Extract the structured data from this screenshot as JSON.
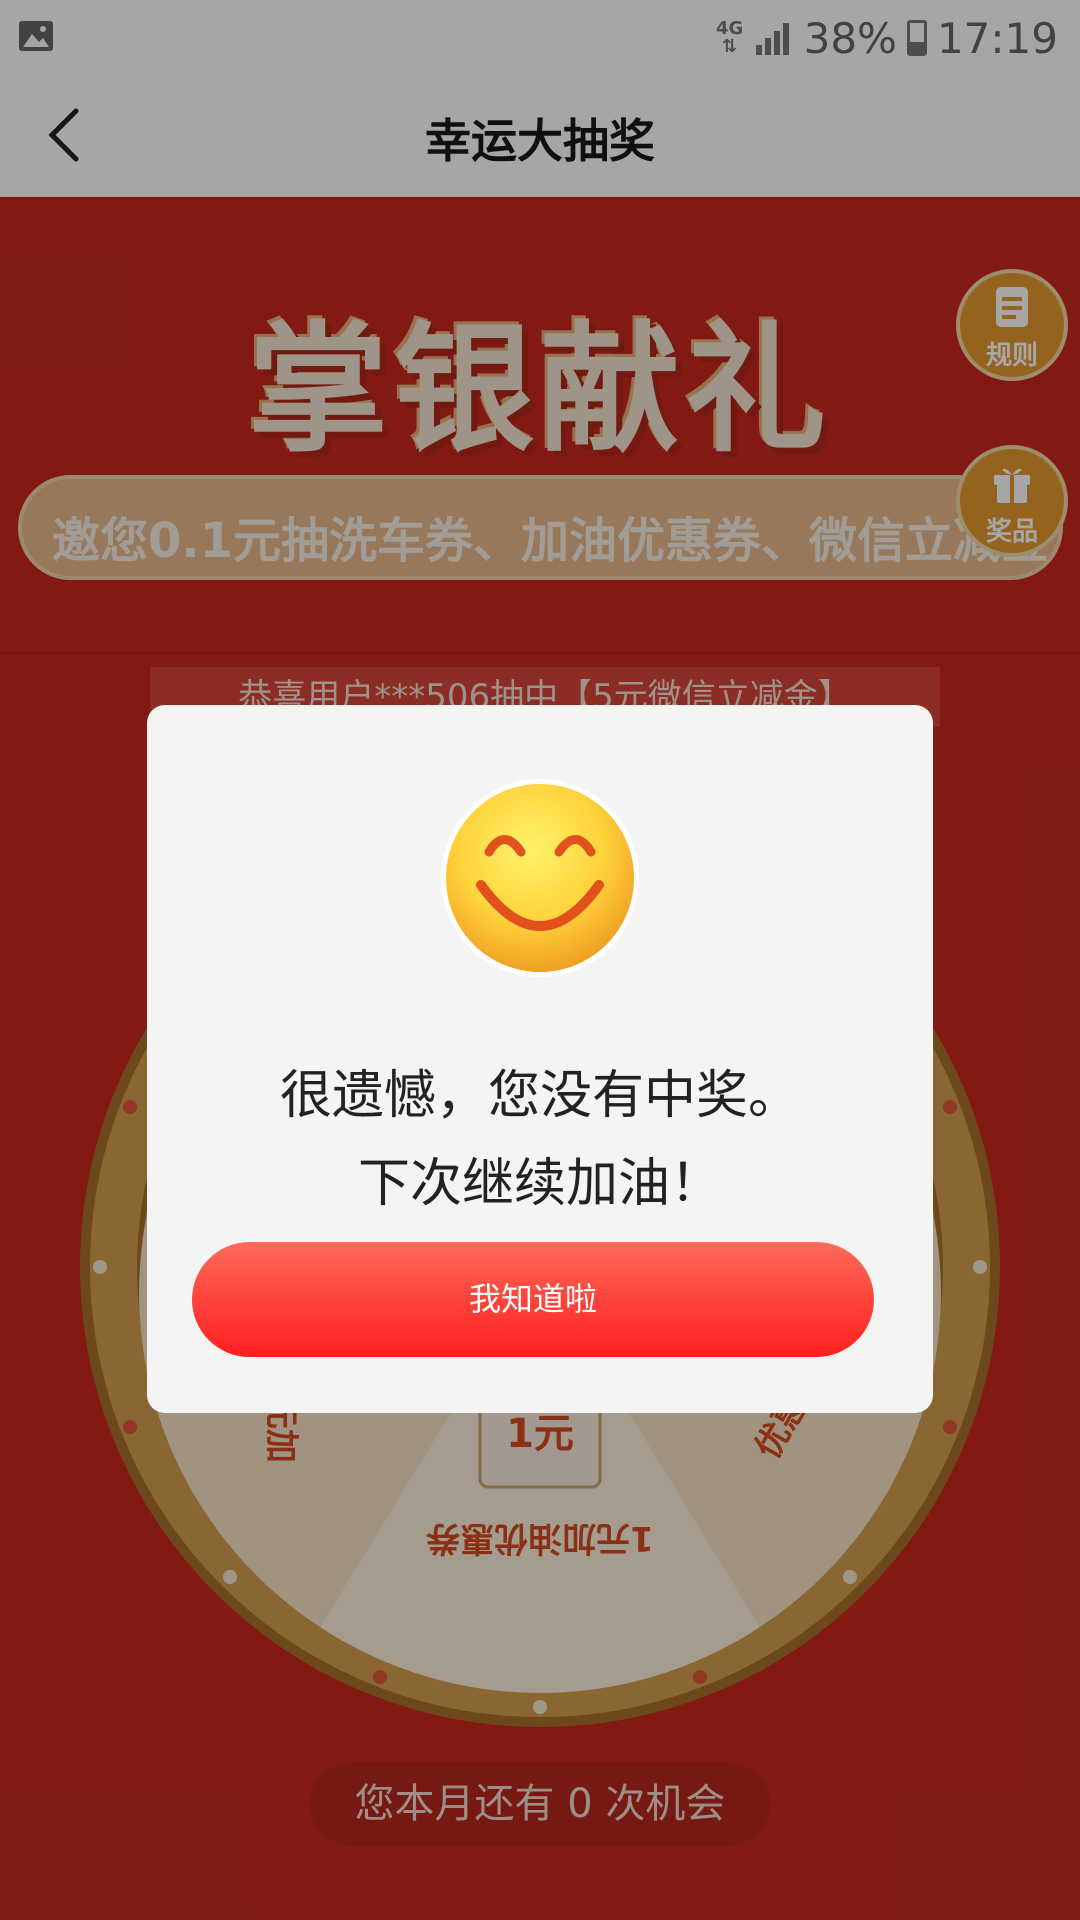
{
  "status_bar": {
    "network": "4G",
    "battery": "38%",
    "battery_level": 0.38,
    "time": "17:19",
    "left_icon": "image-icon"
  },
  "nav": {
    "title": "幸运大抽奖",
    "back_icon": "chevron-left-icon"
  },
  "banner": {
    "title": "掌银献礼",
    "subtitle": "邀您0.1元抽洗车券、加油优惠券、微信立减金"
  },
  "side_buttons": {
    "rules_label": "规则",
    "prizes_label": "奖品"
  },
  "ticker": {
    "text": "恭喜用户***506抽中【5元微信立减金】"
  },
  "wheel": {
    "segments": [
      "1元加油优惠券",
      "5元加",
      "优惠券"
    ],
    "center_label": "1元"
  },
  "chances": {
    "text": "您本月还有 0 次机会"
  },
  "modal": {
    "line1": "很遗憾，您没有中奖。",
    "line2": "下次继续加油！",
    "button_label": "我知道啦"
  },
  "colors": {
    "page_bg": "#c8281e",
    "button_gradient_top": "#ff6a5a",
    "button_gradient_bottom": "#ff1f1f",
    "modal_bg": "#f5f4f4"
  }
}
